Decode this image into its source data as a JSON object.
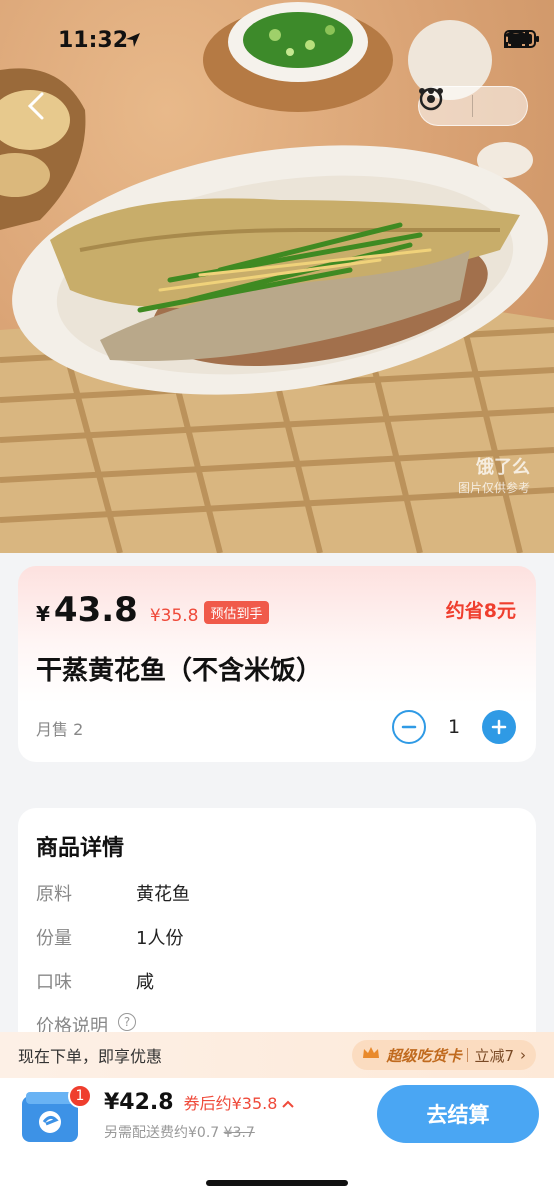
{
  "status": {
    "time": "11:32"
  },
  "hero": {
    "watermark_logo": "饿了么",
    "watermark_note": "图片仅供参考"
  },
  "product": {
    "currency": "¥",
    "price": "43.8",
    "estimated_price": "¥35.8",
    "estimated_badge": "预估到手",
    "savings": "约省8元",
    "title": "干蒸黄花鱼（不含米饭）",
    "monthly_sales": "月售 2",
    "quantity": "1"
  },
  "details": {
    "heading": "商品详情",
    "rows": [
      {
        "key": "原料",
        "value": "黄花鱼"
      },
      {
        "key": "份量",
        "value": "1人份"
      },
      {
        "key": "口味",
        "value": "咸"
      },
      {
        "key": "价格说明",
        "value": ""
      }
    ]
  },
  "promo": {
    "text": "现在下单，即享优惠",
    "card_name": "超级吃货卡",
    "reduce": "立减7",
    "chevron": "›"
  },
  "checkout": {
    "cart_count": "1",
    "total": "¥42.8",
    "coupon_price": "券后约¥35.8",
    "delivery_fee_label": "另需配送费约¥0.7",
    "delivery_fee_old": "¥3.7",
    "button": "去结算"
  },
  "colors": {
    "accent_blue": "#4aa6f3",
    "price_red": "#ef3e2e",
    "promo_brown": "#c06a1e"
  },
  "icons": [
    "location-arrow-icon",
    "signal-icon",
    "wifi-icon",
    "battery-icon",
    "back-chevron-icon",
    "more-dots-icon",
    "target-close-icon",
    "info-icon",
    "crown-icon",
    "chevron-up-icon",
    "shopping-bag-icon"
  ]
}
